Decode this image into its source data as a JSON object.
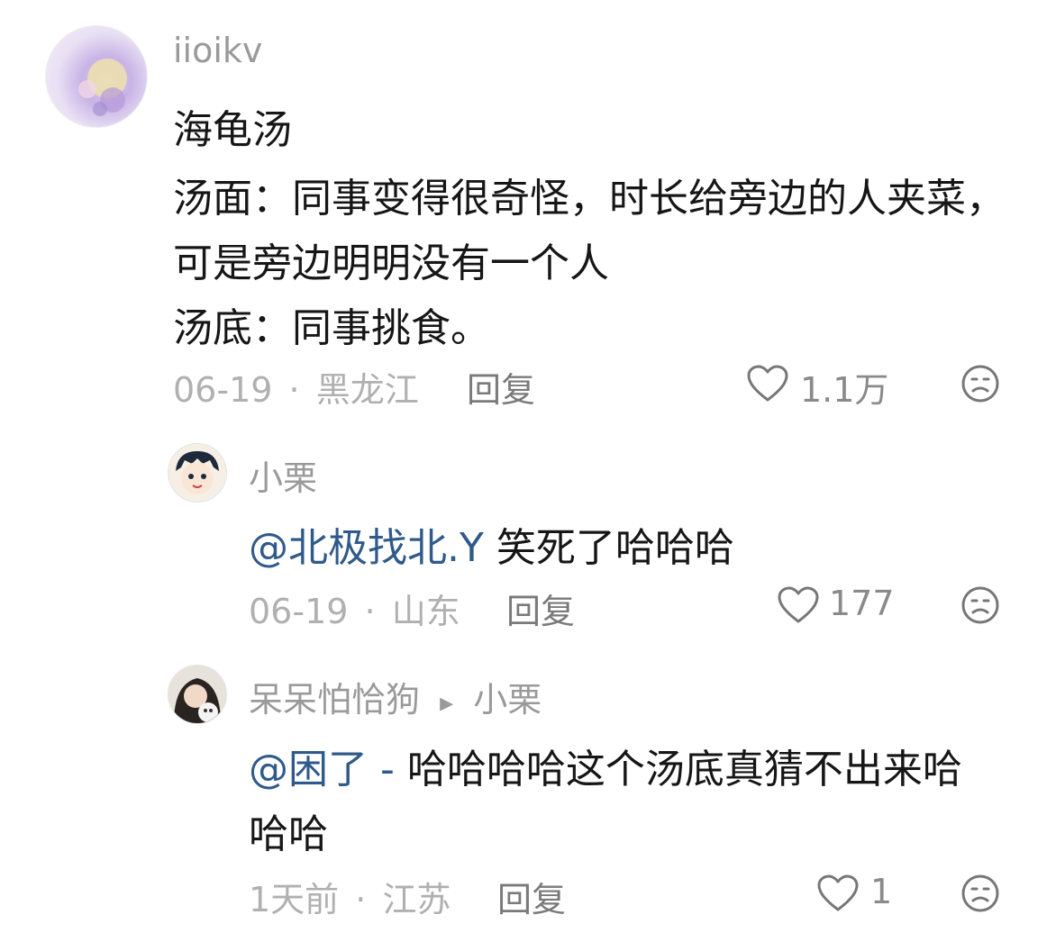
{
  "comment": {
    "username": "iioikv",
    "title": "海龟汤",
    "line1": "汤面：同事变得很奇怪，时长给旁边的人夹菜，",
    "line2": "可是旁边明明没有一个人",
    "line3": "汤底：同事挑食。",
    "date": "06-19",
    "sep": "·",
    "region": "黑龙江",
    "reply_label": "回复",
    "likes": "1.1万"
  },
  "reply1": {
    "username": "小栗",
    "mention": "@北极找北.Y",
    "text": "笑死了哈哈哈",
    "date": "06-19",
    "sep": "·",
    "region": "山东",
    "reply_label": "回复",
    "likes": "177"
  },
  "reply2": {
    "username": "呆呆怕恰狗",
    "arrow": "▸",
    "reply_to": "小栗",
    "mention": "@困了 -",
    "text_line1": "哈哈哈哈这个汤底真猜不出来哈",
    "text_line2": "哈哈",
    "date": "1天前",
    "sep": "·",
    "region": "江苏",
    "reply_label": "回复",
    "likes": "1"
  }
}
